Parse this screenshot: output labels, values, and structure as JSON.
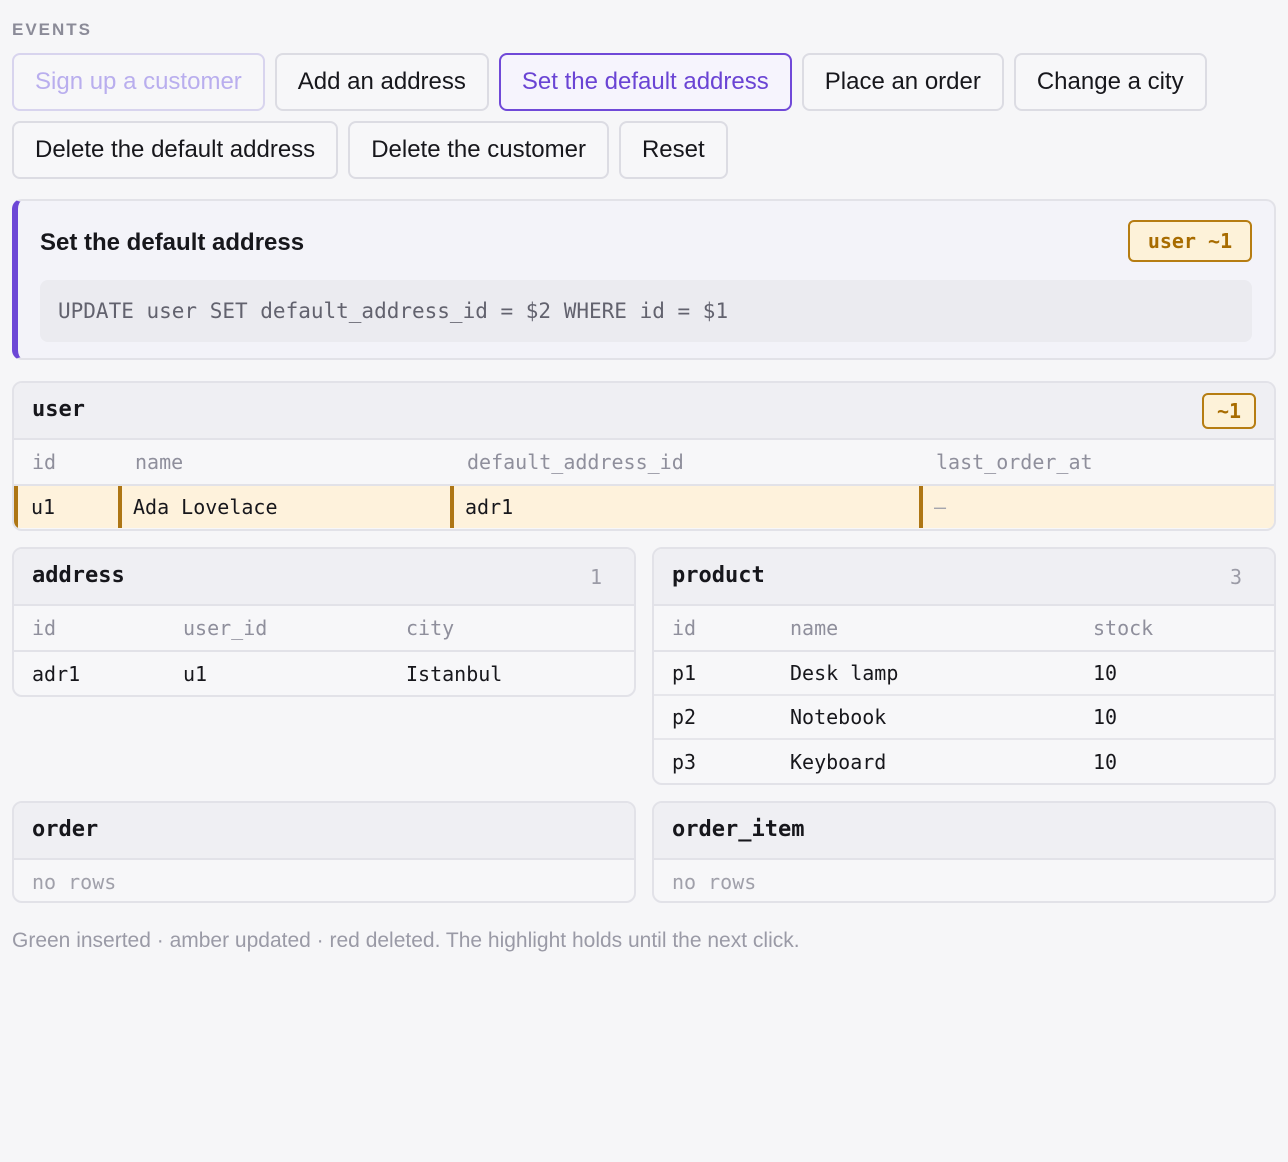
{
  "events_label": "EVENTS",
  "buttons": {
    "sign_up": "Sign up a customer",
    "add_address": "Add an address",
    "set_default": "Set the default address",
    "place_order": "Place an order",
    "change_city": "Change a city",
    "delete_default": "Delete the default address",
    "delete_customer": "Delete the customer",
    "reset": "Reset"
  },
  "statement": {
    "title": "Set the default address",
    "badge": "user ~1",
    "sql": "UPDATE user SET default_address_id = $2 WHERE id = $1"
  },
  "tables": {
    "user": {
      "name": "user",
      "badge": "~1",
      "columns": [
        "id",
        "name",
        "default_address_id",
        "last_order_at"
      ],
      "rows": [
        [
          "u1",
          "Ada Lovelace",
          "adr1",
          "—"
        ]
      ]
    },
    "address": {
      "name": "address",
      "count": "1",
      "columns": [
        "id",
        "user_id",
        "city"
      ],
      "rows": [
        [
          "adr1",
          "u1",
          "Istanbul"
        ]
      ]
    },
    "product": {
      "name": "product",
      "count": "3",
      "columns": [
        "id",
        "name",
        "stock"
      ],
      "rows": [
        [
          "p1",
          "Desk lamp",
          "10"
        ],
        [
          "p2",
          "Notebook",
          "10"
        ],
        [
          "p3",
          "Keyboard",
          "10"
        ]
      ]
    },
    "order": {
      "name": "order",
      "empty": "no rows"
    },
    "order_item": {
      "name": "order_item",
      "empty": "no rows"
    }
  },
  "footer": "Green inserted · amber updated · red deleted. The highlight holds until the next click.",
  "colors": {
    "accent": "#6d47d6",
    "updated": "#ae7614",
    "updated_bg": "#fef2dc"
  }
}
